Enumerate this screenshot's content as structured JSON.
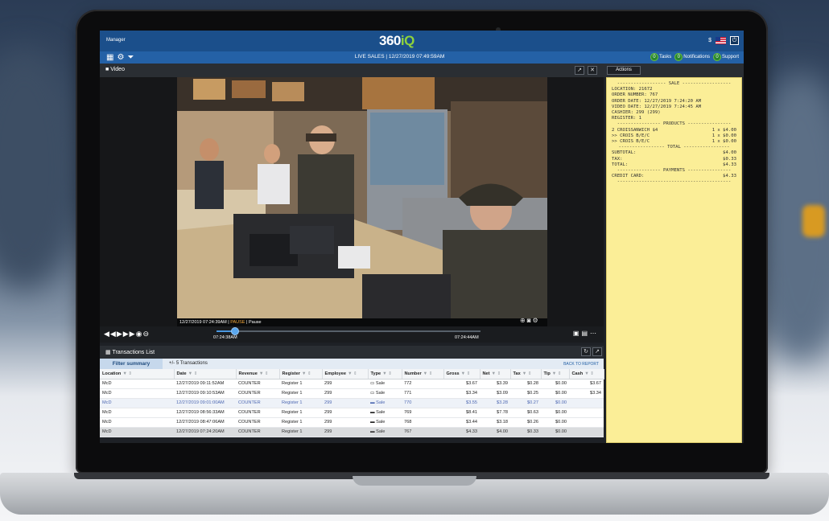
{
  "app": {
    "brand_main": "360",
    "brand_accent": "iQ",
    "role": "Manager",
    "currency": "$",
    "live_label": "LIVE SALES | 12/27/2019 07:49:59AM",
    "badges": [
      {
        "count": "0",
        "label": "Tasks"
      },
      {
        "count": "0",
        "label": "Notifications"
      },
      {
        "count": "0",
        "label": "Support"
      }
    ],
    "colors": {
      "topbar": "#1b4f8b",
      "toolbar": "#2461a6",
      "accent": "#8fd33b",
      "receipt": "#fbee97"
    }
  },
  "video": {
    "title": "Video",
    "timestamp": "12/27/2019 07:24:39AM",
    "state": "PAUSE",
    "state_label": "Pause",
    "start_time": "07:24:38AM",
    "end_time": "07:24:44AM",
    "progress": 0.07
  },
  "transactions": {
    "title": "Transactions List",
    "filter_label": "Filter summary",
    "count_label": "+/- 5 Transactions",
    "back_label": "BACK TO REPORT",
    "columns": [
      "Location",
      "Date",
      "Revenue",
      "Register",
      "Employee",
      "Type",
      "Number",
      "Gross",
      "Net",
      "Tax",
      "Tip",
      "Cash"
    ],
    "rows": [
      [
        "McD",
        "12/27/2019 09:11:52AM",
        "COUNTER",
        "Register 1",
        "299",
        "Sale",
        "772",
        "$3.67",
        "$3.39",
        "$0.28",
        "$0.00",
        "$3.67"
      ],
      [
        "McD",
        "12/27/2019 09:10:53AM",
        "COUNTER",
        "Register 1",
        "299",
        "Sale",
        "771",
        "$3.34",
        "$3.09",
        "$0.25",
        "$0.00",
        "$3.34"
      ],
      [
        "McD",
        "12/27/2019 09:01:00AM",
        "COUNTER",
        "Register 1",
        "299",
        "Sale",
        "770",
        "$3.55",
        "$3.28",
        "$0.27",
        "$0.00",
        ""
      ],
      [
        "McD",
        "12/27/2019 08:56:33AM",
        "COUNTER",
        "Register 1",
        "299",
        "Sale",
        "769",
        "$8.41",
        "$7.78",
        "$0.63",
        "$0.00",
        ""
      ],
      [
        "McD",
        "12/27/2019 08:47:06AM",
        "COUNTER",
        "Register 1",
        "299",
        "Sale",
        "768",
        "$3.44",
        "$3.18",
        "$0.26",
        "$0.00",
        ""
      ],
      [
        "McD",
        "12/27/2019 07:24:20AM",
        "COUNTER",
        "Register 1",
        "299",
        "Sale",
        "767",
        "$4.33",
        "$4.00",
        "$0.33",
        "$0.00",
        ""
      ]
    ]
  },
  "actions": {
    "label": "Actions"
  },
  "receipt": {
    "sale_header": "------------------ SALE ------------------",
    "lines": [
      "LOCATION: 21672",
      "ORDER NUMBER: 767",
      "ORDER DATE: 12/27/2019 7:24:20 AM",
      "VIDEO DATE: 12/27/2019 7:24:45 AM",
      "CASHIER: 299 (299)",
      "REGISTER: 1"
    ],
    "products_header": "---------------- PRODUCTS ----------------",
    "products": [
      {
        "name": "2 CROISSANWICH $4",
        "qty": "1 x $4.00"
      },
      {
        "name": ">> CROIS B/E/C",
        "qty": "1 x $0.00"
      },
      {
        "name": ">> CROIS B/E/C",
        "qty": "1 x $0.00"
      }
    ],
    "total_header": "----------------- TOTAL -----------------",
    "totals": [
      {
        "label": "SUBTOTAL:",
        "value": "$4.00"
      },
      {
        "label": "TAX:",
        "value": "$0.33"
      },
      {
        "label": "TOTAL:",
        "value": "$4.33"
      }
    ],
    "payments_header": "---------------- PAYMENTS ----------------",
    "payments": [
      {
        "label": "CREDIT CARD:",
        "value": "$4.33"
      }
    ],
    "footer_rule": "------------------------------------------"
  }
}
